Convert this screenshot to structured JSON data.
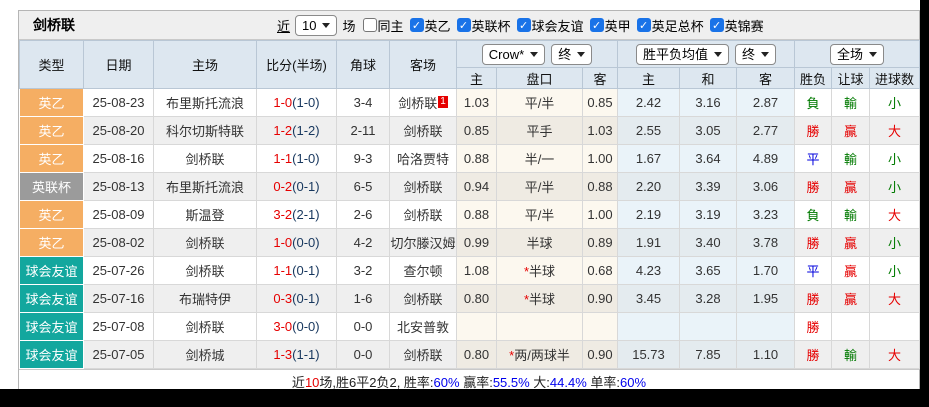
{
  "title_bar": {
    "title": "剑桥联",
    "recent_link": "近",
    "recent_select": "10",
    "matches_label": "场",
    "filters": [
      {
        "label": "同主",
        "checked": false
      },
      {
        "label": "英乙",
        "checked": true
      },
      {
        "label": "英联杯",
        "checked": true
      },
      {
        "label": "球会友谊",
        "checked": true
      },
      {
        "label": "英甲",
        "checked": true
      },
      {
        "label": "英足总杯",
        "checked": true
      },
      {
        "label": "英锦赛",
        "checked": true
      }
    ]
  },
  "header": {
    "left_columns": [
      "类型",
      "日期",
      "主场",
      "比分(半场)",
      "角球",
      "客场"
    ],
    "group_selects": {
      "odds_source": "Crow*",
      "odds_state": "终",
      "avg_type": "胜平负均值",
      "avg_state": "终",
      "scope": "全场"
    },
    "sub_columns": [
      "主",
      "盘口",
      "客",
      "主",
      "和",
      "客",
      "胜负",
      "让球",
      "进球数"
    ]
  },
  "league_colors": {
    "英乙": "#f5ae63",
    "英联杯": "#9b9b9b",
    "球会友谊": "#13a79e"
  },
  "result_colors": {
    "r": "#e60000",
    "g": "#007a00",
    "b": "#0000dd"
  },
  "table": {
    "rows": [
      {
        "league": "英乙",
        "date": "25-08-23",
        "home": "布里斯托流浪",
        "home_green": false,
        "score": "1-0",
        "half": "(1-0)",
        "corner": "3-4",
        "away": "剑桥联",
        "away_green": true,
        "away_badge": "1",
        "odds_home": "1.03",
        "handicap_star": false,
        "handicap": "平/半",
        "odds_away": "0.85",
        "avg_home": "2.42",
        "avg_draw": "3.16",
        "avg_away": "2.87",
        "res_outcome": {
          "t": "負",
          "c": "g"
        },
        "res_handicap": {
          "t": "輸",
          "c": "g"
        },
        "res_goals": {
          "t": "小",
          "c": "g"
        }
      },
      {
        "league": "英乙",
        "date": "25-08-20",
        "home": "科尔切斯特联",
        "home_green": false,
        "score": "1-2",
        "half": "(1-2)",
        "corner": "2-11",
        "away": "剑桥联",
        "away_green": true,
        "away_badge": "",
        "odds_home": "0.85",
        "handicap_star": false,
        "handicap": "平手",
        "odds_away": "1.03",
        "avg_home": "2.55",
        "avg_draw": "3.05",
        "avg_away": "2.77",
        "res_outcome": {
          "t": "勝",
          "c": "r"
        },
        "res_handicap": {
          "t": "贏",
          "c": "r"
        },
        "res_goals": {
          "t": "大",
          "c": "r"
        }
      },
      {
        "league": "英乙",
        "date": "25-08-16",
        "home": "剑桥联",
        "home_green": true,
        "score": "1-1",
        "half": "(1-0)",
        "corner": "9-3",
        "away": "哈洛贾特",
        "away_green": false,
        "away_badge": "",
        "odds_home": "0.88",
        "handicap_star": false,
        "handicap": "半/一",
        "odds_away": "1.00",
        "avg_home": "1.67",
        "avg_draw": "3.64",
        "avg_away": "4.89",
        "res_outcome": {
          "t": "平",
          "c": "b"
        },
        "res_handicap": {
          "t": "輸",
          "c": "g"
        },
        "res_goals": {
          "t": "小",
          "c": "g"
        }
      },
      {
        "league": "英联杯",
        "date": "25-08-13",
        "home": "布里斯托流浪",
        "home_green": false,
        "score": "0-2",
        "half": "(0-1)",
        "corner": "6-5",
        "away": "剑桥联",
        "away_green": true,
        "away_badge": "",
        "odds_home": "0.94",
        "handicap_star": false,
        "handicap": "平/半",
        "odds_away": "0.88",
        "avg_home": "2.20",
        "avg_draw": "3.39",
        "avg_away": "3.06",
        "res_outcome": {
          "t": "勝",
          "c": "r"
        },
        "res_handicap": {
          "t": "贏",
          "c": "r"
        },
        "res_goals": {
          "t": "小",
          "c": "g"
        }
      },
      {
        "league": "英乙",
        "date": "25-08-09",
        "home": "斯温登",
        "home_green": false,
        "score": "3-2",
        "half": "(2-1)",
        "corner": "2-6",
        "away": "剑桥联",
        "away_green": true,
        "away_badge": "",
        "odds_home": "0.88",
        "handicap_star": false,
        "handicap": "平/半",
        "odds_away": "1.00",
        "avg_home": "2.19",
        "avg_draw": "3.19",
        "avg_away": "3.23",
        "res_outcome": {
          "t": "負",
          "c": "g"
        },
        "res_handicap": {
          "t": "輸",
          "c": "g"
        },
        "res_goals": {
          "t": "大",
          "c": "r"
        }
      },
      {
        "league": "英乙",
        "date": "25-08-02",
        "home": "剑桥联",
        "home_green": true,
        "score": "1-0",
        "half": "(0-0)",
        "corner": "4-2",
        "away": "切尔滕汉姆",
        "away_green": false,
        "away_badge": "",
        "odds_home": "0.99",
        "handicap_star": false,
        "handicap": "半球",
        "odds_away": "0.89",
        "avg_home": "1.91",
        "avg_draw": "3.40",
        "avg_away": "3.78",
        "res_outcome": {
          "t": "勝",
          "c": "r"
        },
        "res_handicap": {
          "t": "贏",
          "c": "r"
        },
        "res_goals": {
          "t": "小",
          "c": "g"
        }
      },
      {
        "league": "球会友谊",
        "date": "25-07-26",
        "home": "剑桥联",
        "home_green": true,
        "score": "1-1",
        "half": "(0-1)",
        "corner": "3-2",
        "away": "查尔顿",
        "away_green": false,
        "away_badge": "",
        "odds_home": "1.08",
        "handicap_star": true,
        "handicap": "半球",
        "odds_away": "0.68",
        "avg_home": "4.23",
        "avg_draw": "3.65",
        "avg_away": "1.70",
        "res_outcome": {
          "t": "平",
          "c": "b"
        },
        "res_handicap": {
          "t": "贏",
          "c": "r"
        },
        "res_goals": {
          "t": "小",
          "c": "g"
        }
      },
      {
        "league": "球会友谊",
        "date": "25-07-16",
        "home": "布瑞特伊",
        "home_green": false,
        "score": "0-3",
        "half": "(0-1)",
        "corner": "1-6",
        "away": "剑桥联",
        "away_green": true,
        "away_badge": "",
        "odds_home": "0.80",
        "handicap_star": true,
        "handicap": "半球",
        "odds_away": "0.90",
        "avg_home": "3.45",
        "avg_draw": "3.28",
        "avg_away": "1.95",
        "res_outcome": {
          "t": "勝",
          "c": "r"
        },
        "res_handicap": {
          "t": "贏",
          "c": "r"
        },
        "res_goals": {
          "t": "大",
          "c": "r"
        }
      },
      {
        "league": "球会友谊",
        "date": "25-07-08",
        "home": "剑桥联",
        "home_green": true,
        "score": "3-0",
        "half": "(0-0)",
        "corner": "0-0",
        "away": "北安普敦",
        "away_green": false,
        "away_badge": "",
        "odds_home": "",
        "handicap_star": false,
        "handicap": "",
        "odds_away": "",
        "avg_home": "",
        "avg_draw": "",
        "avg_away": "",
        "res_outcome": {
          "t": "勝",
          "c": "r"
        },
        "res_handicap": {
          "t": "",
          "c": ""
        },
        "res_goals": {
          "t": "",
          "c": ""
        }
      },
      {
        "league": "球会友谊",
        "date": "25-07-05",
        "home": "剑桥城",
        "home_green": false,
        "score": "1-3",
        "half": "(1-1)",
        "corner": "0-0",
        "away": "剑桥联",
        "away_green": true,
        "away_badge": "",
        "odds_home": "0.80",
        "handicap_star": true,
        "handicap": "两/两球半",
        "odds_away": "0.90",
        "avg_home": "15.73",
        "avg_draw": "7.85",
        "avg_away": "1.10",
        "res_outcome": {
          "t": "勝",
          "c": "r"
        },
        "res_handicap": {
          "t": "輸",
          "c": "g"
        },
        "res_goals": {
          "t": "大",
          "c": "r"
        }
      }
    ]
  },
  "footer": {
    "segments": [
      {
        "t": "近",
        "c": "k"
      },
      {
        "t": "10",
        "c": "r"
      },
      {
        "t": "场,胜6平2负2, 胜率:",
        "c": "k"
      },
      {
        "t": "60%",
        "c": "b"
      },
      {
        "t": " 赢率:",
        "c": "k"
      },
      {
        "t": "55.5%",
        "c": "b"
      },
      {
        "t": " 大:",
        "c": "k"
      },
      {
        "t": "44.4%",
        "c": "b"
      },
      {
        "t": " 单率:",
        "c": "k"
      },
      {
        "t": "60%",
        "c": "b"
      }
    ]
  }
}
